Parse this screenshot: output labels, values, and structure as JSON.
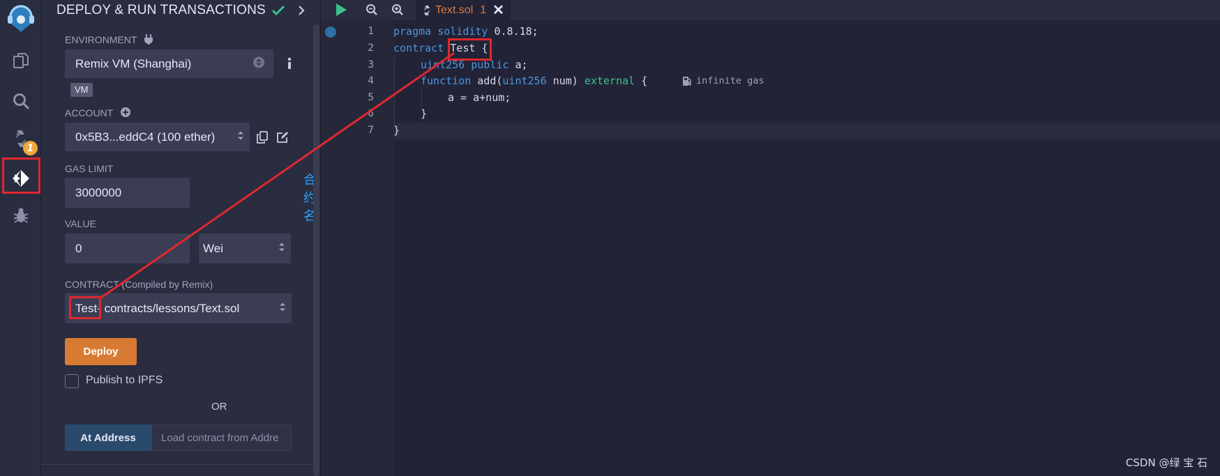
{
  "panel": {
    "title": "DEPLOY & RUN TRANSACTIONS",
    "environment_label": "ENVIRONMENT",
    "environment_value": "Remix VM (Shanghai)",
    "vm_chip": "VM",
    "account_label": "ACCOUNT",
    "account_value": "0x5B3...eddC4 (100 ether)",
    "gas_limit_label": "GAS LIMIT",
    "gas_limit_value": "3000000",
    "value_label": "VALUE",
    "value_amount": "0",
    "value_unit": "Wei",
    "contract_label": "CONTRACT",
    "contract_sub": "(Compiled by Remix)",
    "contract_name": "Test",
    "contract_path": " - contracts/lessons/Text.sol",
    "deploy_label": "Deploy",
    "publish_label": "Publish to IPFS",
    "or_label": "OR",
    "at_address_label": "At Address",
    "address_placeholder": "Load contract from Addre"
  },
  "rail": {
    "badge": "1",
    "icons": [
      "remix-logo-icon",
      "file-explorer-icon",
      "search-icon",
      "solidity-compiler-icon",
      "deploy-run-icon",
      "debugger-icon"
    ]
  },
  "annotation": {
    "text": "合约名",
    "color": "#2aa5ff",
    "box_color": "#e0282e"
  },
  "editor": {
    "tab_label": "Text.sol",
    "tab_count": "1",
    "line_numbers": [
      "1",
      "2",
      "3",
      "4",
      "5",
      "6",
      "7"
    ],
    "gas_hint": "infinite gas",
    "code": {
      "l1_kw": "pragma",
      "l1_kw2": "solidity",
      "l1_rest": " 0.8.18;",
      "l2_kw": "contract",
      "l2_name": "Test",
      "l2_rest": " {",
      "l3_type": "uint256",
      "l3_vis": "public",
      "l3_rest": " a;",
      "l4_kw": "function",
      "l4_name": " add(",
      "l4_type": "uint256",
      "l4_param": " num) ",
      "l4_ext": "external",
      "l4_rest": " {",
      "l5": "a = a+num;",
      "l6": "}",
      "l7": "}"
    }
  },
  "watermark": "CSDN @绿 宝 石",
  "colors": {
    "panel_bg": "#2a2c3f",
    "editor_bg": "#222336",
    "deploy_btn": "#d97a34",
    "at_address_btn": "#2a4a6d",
    "tab_text": "#e0783a",
    "keyword": "#4b97dd",
    "external": "#3bc28c"
  }
}
